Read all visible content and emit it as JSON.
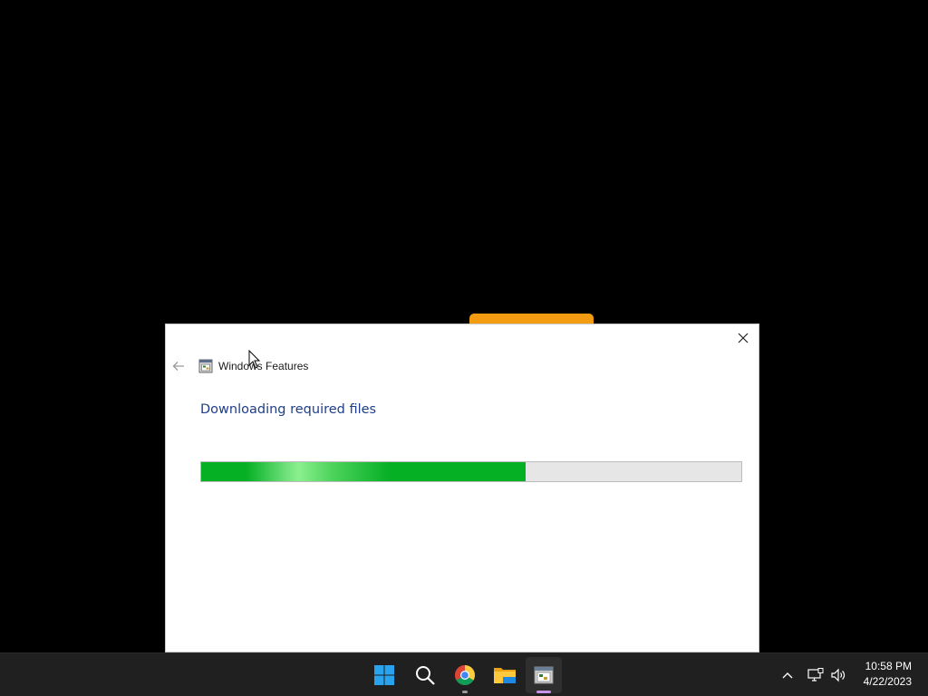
{
  "dialog": {
    "title": "Windows Features",
    "heading": "Downloading required files",
    "progress": 0.6
  },
  "taskbar": {
    "apps": [
      {
        "name": "Start",
        "icon": "windows-logo-icon"
      },
      {
        "name": "Search",
        "icon": "search-icon"
      },
      {
        "name": "Google Chrome",
        "icon": "chrome-icon"
      },
      {
        "name": "File Explorer",
        "icon": "folder-icon"
      },
      {
        "name": "Windows Features",
        "icon": "windows-features-icon"
      }
    ],
    "tray_icons": [
      "chevron-up-icon",
      "network-icon",
      "speaker-icon"
    ],
    "time": "10:58 PM",
    "date": "4/22/2023"
  },
  "colors": {
    "desktop_background": "#000000",
    "progress_fill": "#06b025",
    "heading_text": "#1e3e8c",
    "taskbar": "#202020"
  }
}
